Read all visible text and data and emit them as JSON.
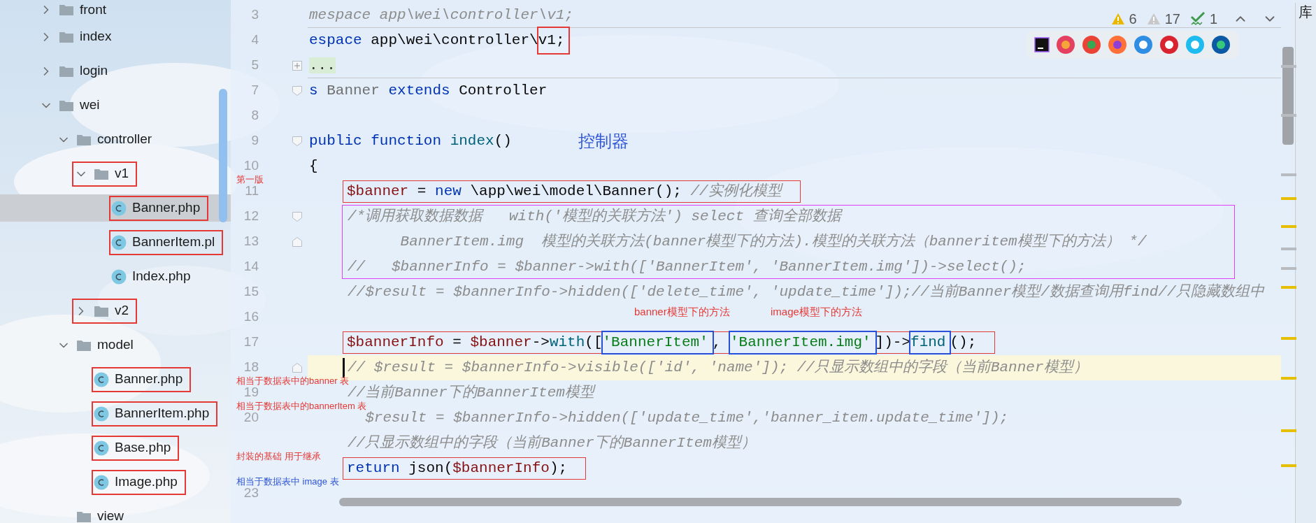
{
  "project_tree": {
    "items": [
      {
        "name": "front",
        "kind": "folder",
        "expanded": false
      },
      {
        "name": "index",
        "kind": "folder",
        "expanded": false
      },
      {
        "name": "login",
        "kind": "folder",
        "expanded": false
      },
      {
        "name": "wei",
        "kind": "folder",
        "expanded": true,
        "children": [
          {
            "name": "controller",
            "kind": "folder",
            "expanded": true,
            "children": [
              {
                "name": "v1",
                "kind": "folder",
                "expanded": true,
                "box": {
                  "color": "#e53935"
                },
                "note": {
                  "text": "第一版",
                  "color": "#e53935"
                },
                "children": [
                  {
                    "name": "Banner.php",
                    "kind": "class",
                    "selected": true,
                    "box": {
                      "color": "#e53935"
                    }
                  },
                  {
                    "name": "BannerItem.pl",
                    "kind": "class",
                    "selected": false,
                    "box": {
                      "color": "#e53935"
                    }
                  },
                  {
                    "name": "Index.php",
                    "kind": "class",
                    "selected": false
                  }
                ]
              },
              {
                "name": "v2",
                "kind": "folder",
                "expanded": false,
                "box": {
                  "color": "#e53935"
                }
              }
            ]
          },
          {
            "name": "model",
            "kind": "folder",
            "expanded": true,
            "children": [
              {
                "name": "Banner.php",
                "kind": "class",
                "selected": false,
                "box": {
                  "color": "#e53935"
                },
                "note": {
                  "text": "相当于数据表中的banner 表",
                  "color": "#e53935"
                }
              },
              {
                "name": "BannerItem.php",
                "kind": "class",
                "selected": false,
                "box": {
                  "color": "#e53935"
                },
                "note": {
                  "text": "相当于数据表中的bannerItem 表",
                  "color": "#e53935"
                }
              },
              {
                "name": "Base.php",
                "kind": "class",
                "selected": false,
                "box": {
                  "color": "#e53935"
                },
                "note": {
                  "text": "封装的基础 用于继承",
                  "color": "#e53935"
                }
              },
              {
                "name": "Image.php",
                "kind": "class",
                "selected": false,
                "box": {
                  "color": "#e53935"
                },
                "note": {
                  "text": "相当于数据表中 image 表",
                  "color": "#2f55d4"
                }
              }
            ]
          },
          {
            "name": "view",
            "kind": "folder"
          }
        ]
      }
    ]
  },
  "editor": {
    "lines": [
      {
        "kind": "line",
        "number": "3",
        "divider": true,
        "segments": [
          {
            "text": "mespace app\\wei\\controller\\v1;",
            "kind": "sticky"
          }
        ]
      },
      {
        "kind": "line",
        "number": "4",
        "segments": [
          {
            "text": "espace",
            "kind": "keyword"
          },
          {
            "text": " app\\wei\\controller\\",
            "kind": "plain"
          },
          {
            "text": "v1;",
            "kind": "plain",
            "box": {
              "color": "#e53935"
            }
          }
        ]
      },
      {
        "kind": "line",
        "number": "5",
        "fold": {
          "kind": "plus"
        },
        "divider": true,
        "segments": [
          {
            "text": "...",
            "kind": "folded"
          }
        ]
      },
      {
        "kind": "line",
        "number": "7",
        "fold": {
          "kind": "start"
        },
        "segments": [
          {
            "text": "s",
            "kind": "keyword"
          },
          {
            "text": " Banner ",
            "kind": "dim"
          },
          {
            "text": "extends",
            "kind": "keyword"
          },
          {
            "text": " Controller",
            "kind": "plain"
          }
        ]
      },
      {
        "kind": "line",
        "number": "8"
      },
      {
        "kind": "line",
        "number": "9",
        "fold": {
          "kind": "start"
        },
        "segments": [
          {
            "text": "public function",
            "kind": "keyword"
          },
          {
            "text": " index",
            "kind": "call"
          },
          {
            "text": "()",
            "kind": "plain"
          }
        ],
        "notes": [
          {
            "text": "控制器",
            "color": "#2f55d4",
            "kind": "heading"
          }
        ]
      },
      {
        "kind": "line",
        "number": "10",
        "segments": [
          {
            "text": "{",
            "kind": "plain"
          }
        ]
      },
      {
        "kind": "block",
        "lines": [
          {
            "kind": "line",
            "number": "11",
            "box": {
              "color": "#e53935"
            },
            "segments": [
              {
                "text": "$banner",
                "kind": "var"
              },
              {
                "text": " = ",
                "kind": "plain"
              },
              {
                "text": "new",
                "kind": "keyword"
              },
              {
                "text": " \\app\\wei\\model\\Banner(); ",
                "kind": "plain"
              },
              {
                "text": "//实例化模型",
                "kind": "comment"
              }
            ]
          },
          {
            "kind": "group",
            "box": {
              "color": "#e040fb"
            },
            "lines": [
              {
                "kind": "line",
                "number": "12",
                "fold": {
                  "kind": "start"
                },
                "segments": [
                  {
                    "text": "/*调用获取数据数据   with('模型的关联方法') select 查询全部数据",
                    "kind": "comment"
                  }
                ]
              },
              {
                "kind": "line",
                "number": "13",
                "fold": {
                  "kind": "end"
                },
                "segments": [
                  {
                    "text": "      BannerItem.img  模型的关联方法(banner模型下的方法).模型的关联方法（banneritem模型下的方法） */",
                    "kind": "comment"
                  }
                ]
              },
              {
                "kind": "line",
                "number": "14",
                "segments": [
                  {
                    "text": "//   $bannerInfo = $banner->with(['BannerItem', 'BannerItem.img'])->select();",
                    "kind": "comment"
                  }
                ]
              }
            ]
          },
          {
            "kind": "line",
            "number": "15",
            "segments": [
              {
                "text": "//$result = $bannerInfo->hidden(['delete_time', 'update_time']);//当前Banner模型/数据查询用find//只隐藏数组中",
                "kind": "comment"
              }
            ]
          },
          {
            "kind": "line",
            "number": "16",
            "notes": [
              {
                "text": "banner模型下的方法",
                "color": "#e53935",
                "kind": "callout"
              },
              {
                "text": "image模型下的方法",
                "color": "#e53935",
                "kind": "callout"
              }
            ]
          },
          {
            "kind": "line",
            "number": "17",
            "box": {
              "color": "#e53935"
            },
            "segments": [
              {
                "text": "$bannerInfo",
                "kind": "var"
              },
              {
                "text": " = ",
                "kind": "plain"
              },
              {
                "text": "$banner",
                "kind": "var"
              },
              {
                "text": "->",
                "kind": "plain"
              },
              {
                "text": "with",
                "kind": "call"
              },
              {
                "text": "([",
                "kind": "plain"
              },
              {
                "text": "'BannerItem'",
                "kind": "string",
                "box": {
                  "color": "#2b50d8"
                }
              },
              {
                "text": ", ",
                "kind": "plain"
              },
              {
                "text": "'BannerItem.img'",
                "kind": "string",
                "box": {
                  "color": "#2b50d8"
                }
              },
              {
                "text": "])->",
                "kind": "plain"
              },
              {
                "text": "find",
                "kind": "call",
                "box": {
                  "color": "#2b50d8"
                }
              },
              {
                "text": "();",
                "kind": "plain"
              }
            ]
          },
          {
            "kind": "line",
            "number": "18",
            "fold": {
              "kind": "end"
            },
            "current": true,
            "segments": [
              {
                "text": "// $result = $bannerInfo->visible(['id', 'name']); //只显示数组中的字段（当前Banner模型）",
                "kind": "comment"
              }
            ]
          },
          {
            "kind": "line",
            "number": "19",
            "segments": [
              {
                "text": "//当前Banner下的BannerItem模型",
                "kind": "comment"
              }
            ]
          },
          {
            "kind": "line",
            "number": "20",
            "segments": [
              {
                "text": "  $result = $bannerInfo->hidden(['update_time','banner_item.update_time']);",
                "kind": "comment"
              }
            ]
          },
          {
            "kind": "line",
            "segments": [
              {
                "text": "//只显示数组中的字段（当前Banner下的BannerItem模型）",
                "kind": "comment"
              }
            ]
          },
          {
            "kind": "line",
            "box": {
              "color": "#e53935"
            },
            "segments": [
              {
                "text": "return",
                "kind": "keyword"
              },
              {
                "text": " json(",
                "kind": "plain"
              },
              {
                "text": "$bannerInfo",
                "kind": "var"
              },
              {
                "text": ");",
                "kind": "plain"
              }
            ]
          }
        ]
      },
      {
        "kind": "line",
        "number": "23"
      }
    ]
  },
  "inspections": [
    {
      "kind": "warning",
      "count": "6"
    },
    {
      "kind": "weak_warning",
      "count": "17"
    },
    {
      "kind": "typo",
      "count": "1"
    }
  ],
  "side_tab": "库"
}
